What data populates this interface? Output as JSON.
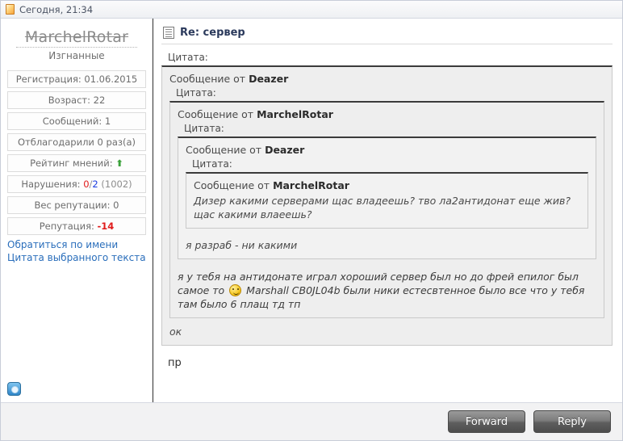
{
  "topbar": {
    "icon": "document-icon",
    "date": "Сегодня, 21:34"
  },
  "sidebar": {
    "username": "MarchelRotar",
    "user_title": "Изгнанные",
    "stats": [
      {
        "label": "Регистрация: 01.06.2015"
      },
      {
        "label": "Возраст: 22"
      },
      {
        "label": "Сообщений: 1"
      },
      {
        "label": "Отблагодарили 0 раз(а)"
      }
    ],
    "rating_label": "Рейтинг мнений:",
    "rating_arrow": "⬆",
    "violations_label": "Нарушения:",
    "violations_current": "0",
    "violations_sep": "/",
    "violations_max": "2",
    "violations_extra": "(1002)",
    "rep_weight": "Вес репутации: 0",
    "reputation_label": "Репутация:",
    "reputation_value": "-14",
    "links": [
      "Обратиться по имени",
      "Цитата выбранного текста"
    ],
    "status_icon": "offline-status-icon"
  },
  "main": {
    "subject_icon": "post-icon",
    "subject": "Re: сервер",
    "quote_label": "Цитата:",
    "quote1": {
      "head_prefix": "Сообщение от ",
      "head_author": "Deazer",
      "quote_label": "Цитата:"
    },
    "quote2": {
      "head_prefix": "Сообщение от ",
      "head_author": "MarchelRotar",
      "quote_label": "Цитата:"
    },
    "quote3": {
      "head_prefix": "Сообщение от ",
      "head_author": "Deazer",
      "quote_label": "Цитата:"
    },
    "quote4": {
      "head_prefix": "Сообщение от ",
      "head_author": "MarchelRotar",
      "text": "Дизер какими серверами щас владеешь? тво ла2антидонат еще жив? щас какими влаеешь?"
    },
    "quote3_text": "я разраб - ни какими",
    "quote2_text_part1": "я у тебя на антидонате играл хороший сервер был но до фрей епилог был самое то",
    "quote2_smiley": "smiley-icon",
    "quote2_text_part2": "Marshall CB0JL04b были ники естесвтенное было все что у тебя там было 6 плащ тд тп",
    "quote1_text": "ок",
    "post_text": "пр"
  },
  "footer": {
    "forward_label": "Forward",
    "reply_label": "Reply"
  }
}
